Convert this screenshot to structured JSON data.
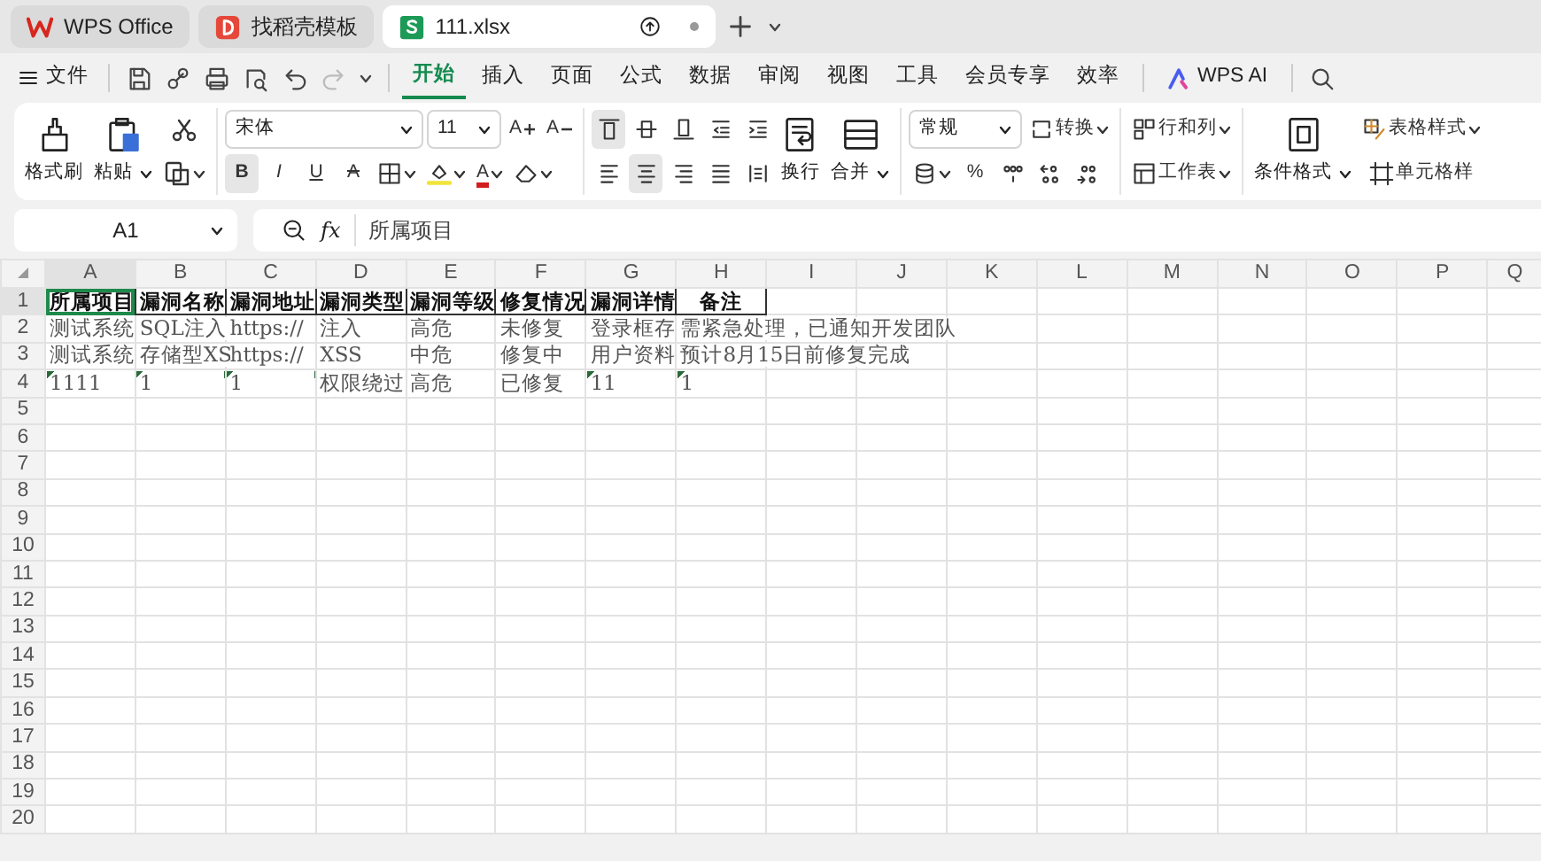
{
  "tabs": [
    {
      "label": "WPS Office",
      "kind": "wps",
      "selected": false
    },
    {
      "label": "找稻壳模板",
      "kind": "docer",
      "selected": false
    },
    {
      "label": "111.xlsx",
      "kind": "sheet",
      "selected": true
    }
  ],
  "menu": {
    "file": "文件",
    "quick_actions": [
      {
        "kind": "save",
        "disabled": false
      },
      {
        "kind": "share",
        "disabled": false
      },
      {
        "kind": "print",
        "disabled": false
      },
      {
        "kind": "preview",
        "disabled": false
      },
      {
        "kind": "undo",
        "disabled": false
      },
      {
        "kind": "redo",
        "disabled": true
      }
    ],
    "tabs": [
      {
        "label": "开始",
        "selected": true
      },
      {
        "label": "插入",
        "selected": false
      },
      {
        "label": "页面",
        "selected": false
      },
      {
        "label": "公式",
        "selected": false
      },
      {
        "label": "数据",
        "selected": false
      },
      {
        "label": "审阅",
        "selected": false
      },
      {
        "label": "视图",
        "selected": false
      },
      {
        "label": "工具",
        "selected": false
      },
      {
        "label": "会员专享",
        "selected": false
      },
      {
        "label": "效率",
        "selected": false
      }
    ],
    "ai": "WPS AI"
  },
  "ribbon": {
    "format_painter": "格式刷",
    "paste": "粘贴",
    "font": "宋体",
    "font_size": "11",
    "font_grow": "A",
    "font_shrink": "A",
    "styles": [
      {
        "label": "B",
        "kind": "bold",
        "selected": true
      },
      {
        "label": "I",
        "kind": "italic",
        "selected": false
      },
      {
        "label": "U",
        "kind": "underline",
        "selected": false
      },
      {
        "label": "A",
        "kind": "strike",
        "selected": false
      }
    ],
    "font_color": "A",
    "align_top": [
      {
        "kind": "top",
        "selected": true
      },
      {
        "kind": "middle",
        "selected": false
      },
      {
        "kind": "bottom",
        "selected": false
      },
      {
        "kind": "outdent",
        "selected": false
      },
      {
        "kind": "indent",
        "selected": false
      }
    ],
    "align_bottom": [
      {
        "kind": "left",
        "selected": false
      },
      {
        "kind": "center",
        "selected": true
      },
      {
        "kind": "right",
        "selected": false
      },
      {
        "kind": "justify",
        "selected": false
      },
      {
        "kind": "distributed",
        "selected": false
      }
    ],
    "wrap": "换行",
    "merge": "合并",
    "number_format": "常规",
    "convert": "转换",
    "percent": "%",
    "rows_cols": "行和列",
    "worksheet": "工作表",
    "conditional": "条件格式",
    "table_style": "表格样式",
    "cell_style": "单元格样"
  },
  "formula_bar": {
    "cell": "A1",
    "fx": "fx",
    "value": "所属项目"
  },
  "sheet": {
    "columns": [
      {
        "label": "A",
        "selected": true
      },
      {
        "label": "B",
        "selected": false
      },
      {
        "label": "C",
        "selected": false
      },
      {
        "label": "D",
        "selected": false
      },
      {
        "label": "E",
        "selected": false
      },
      {
        "label": "F",
        "selected": false
      },
      {
        "label": "G",
        "selected": false
      },
      {
        "label": "H",
        "selected": false
      },
      {
        "label": "I",
        "selected": false
      },
      {
        "label": "J",
        "selected": false
      },
      {
        "label": "K",
        "selected": false
      },
      {
        "label": "L",
        "selected": false
      },
      {
        "label": "M",
        "selected": false
      },
      {
        "label": "N",
        "selected": false
      },
      {
        "label": "O",
        "selected": false
      },
      {
        "label": "P",
        "selected": false
      },
      {
        "label": "Q",
        "selected": false
      }
    ],
    "rows": [
      {
        "number": "1",
        "selected": true,
        "cells": [
          {
            "text": "所属项目",
            "bold": true,
            "flagged": false,
            "selected": true
          },
          {
            "text": "漏洞名称",
            "bold": true,
            "flagged": false,
            "selected": false
          },
          {
            "text": "漏洞地址",
            "bold": true,
            "flagged": false,
            "selected": false
          },
          {
            "text": "漏洞类型",
            "bold": true,
            "flagged": false,
            "selected": false
          },
          {
            "text": "漏洞等级",
            "bold": true,
            "flagged": false,
            "selected": false
          },
          {
            "text": "修复情况",
            "bold": true,
            "flagged": false,
            "selected": false
          },
          {
            "text": "漏洞详情",
            "bold": true,
            "flagged": false,
            "selected": false
          },
          {
            "text": "备注",
            "bold": true,
            "flagged": false,
            "selected": false
          }
        ]
      },
      {
        "number": "2",
        "selected": false,
        "cells": [
          {
            "text": "测试系统",
            "bold": false,
            "flagged": false,
            "selected": false
          },
          {
            "text": "SQL注入",
            "bold": false,
            "flagged": false,
            "selected": false
          },
          {
            "text": "https://",
            "bold": false,
            "flagged": false,
            "selected": false
          },
          {
            "text": "注入",
            "bold": false,
            "flagged": false,
            "selected": false
          },
          {
            "text": "高危",
            "bold": false,
            "flagged": false,
            "selected": false
          },
          {
            "text": "未修复",
            "bold": false,
            "flagged": false,
            "selected": false
          },
          {
            "text": "登录框存",
            "bold": false,
            "flagged": false,
            "selected": false
          },
          {
            "text": "需紧急处理，已通知开发团队",
            "bold": false,
            "flagged": false,
            "selected": false
          }
        ]
      },
      {
        "number": "3",
        "selected": false,
        "cells": [
          {
            "text": "测试系统",
            "bold": false,
            "flagged": false,
            "selected": false
          },
          {
            "text": "存储型XS",
            "bold": false,
            "flagged": false,
            "selected": false
          },
          {
            "text": "https://",
            "bold": false,
            "flagged": false,
            "selected": false
          },
          {
            "text": "XSS",
            "bold": false,
            "flagged": false,
            "selected": false
          },
          {
            "text": "中危",
            "bold": false,
            "flagged": false,
            "selected": false
          },
          {
            "text": "修复中",
            "bold": false,
            "flagged": false,
            "selected": false
          },
          {
            "text": "用户资料",
            "bold": false,
            "flagged": false,
            "selected": false
          },
          {
            "text": "预计8月15日前修复完成",
            "bold": false,
            "flagged": false,
            "selected": false
          }
        ]
      },
      {
        "number": "4",
        "selected": false,
        "cells": [
          {
            "text": "1111",
            "bold": false,
            "flagged": true,
            "selected": false
          },
          {
            "text": "1",
            "bold": false,
            "flagged": true,
            "selected": false
          },
          {
            "text": "1",
            "bold": false,
            "flagged": true,
            "selected": false
          },
          {
            "text": "权限绕过",
            "bold": false,
            "flagged": false,
            "selected": false
          },
          {
            "text": "高危",
            "bold": false,
            "flagged": false,
            "selected": false
          },
          {
            "text": "已修复",
            "bold": false,
            "flagged": false,
            "selected": false
          },
          {
            "text": "11",
            "bold": false,
            "flagged": true,
            "selected": false
          },
          {
            "text": "1",
            "bold": false,
            "flagged": true,
            "selected": false
          }
        ]
      },
      {
        "number": "5",
        "selected": false,
        "cells": []
      },
      {
        "number": "6",
        "selected": false,
        "cells": []
      },
      {
        "number": "7",
        "selected": false,
        "cells": []
      },
      {
        "number": "8",
        "selected": false,
        "cells": []
      },
      {
        "number": "9",
        "selected": false,
        "cells": []
      },
      {
        "number": "10",
        "selected": false,
        "cells": []
      },
      {
        "number": "11",
        "selected": false,
        "cells": []
      },
      {
        "number": "12",
        "selected": false,
        "cells": []
      },
      {
        "number": "13",
        "selected": false,
        "cells": []
      },
      {
        "number": "14",
        "selected": false,
        "cells": []
      },
      {
        "number": "15",
        "selected": false,
        "cells": []
      },
      {
        "number": "16",
        "selected": false,
        "cells": []
      },
      {
        "number": "17",
        "selected": false,
        "cells": []
      },
      {
        "number": "18",
        "selected": false,
        "cells": []
      },
      {
        "number": "19",
        "selected": false,
        "cells": []
      },
      {
        "number": "20",
        "selected": false,
        "cells": []
      }
    ]
  }
}
